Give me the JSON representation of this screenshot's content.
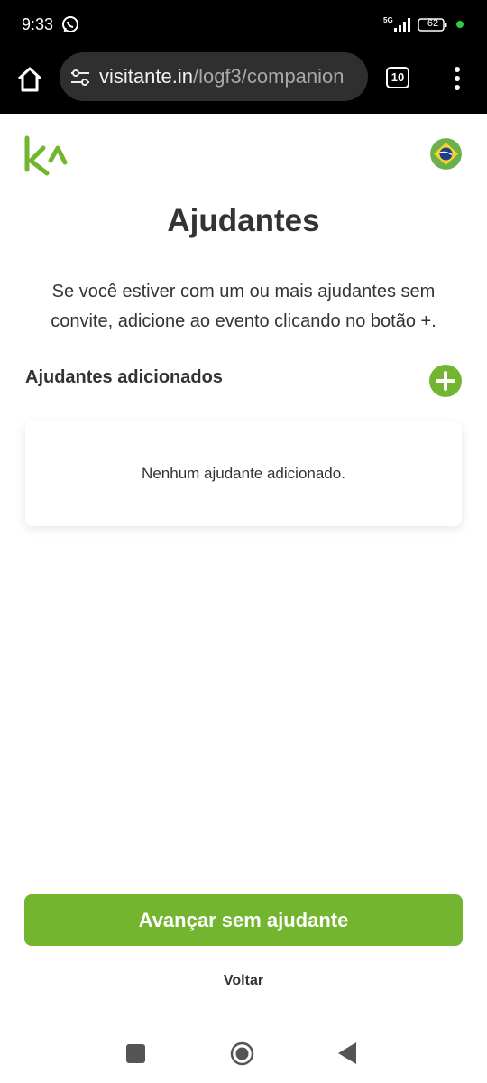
{
  "status_bar": {
    "time": "9:33",
    "network": "5G",
    "battery": "62"
  },
  "browser": {
    "url_domain": "visitante.in",
    "url_path": "/logf3/companion",
    "tab_count": "10"
  },
  "page": {
    "title": "Ajudantes",
    "description": "Se você estiver com um ou mais ajudantes sem convite, adicione ao evento clicando no botão +.",
    "section_label": "Ajudantes adicionados",
    "empty_message": "Nenhum ajudante adicionado.",
    "primary_button": "Avançar sem ajudante",
    "back_link": "Voltar"
  },
  "colors": {
    "brand_green": "#73b52e",
    "text_dark": "#333333",
    "browser_bar": "#000000"
  },
  "icons": [
    "whatsapp-icon",
    "signal-icon",
    "battery-icon",
    "home-icon",
    "site-settings-icon",
    "tabs-icon",
    "menu-icon",
    "logo",
    "brazil-flag-icon",
    "plus-icon",
    "nav-recents-icon",
    "nav-home-icon",
    "nav-back-icon"
  ]
}
